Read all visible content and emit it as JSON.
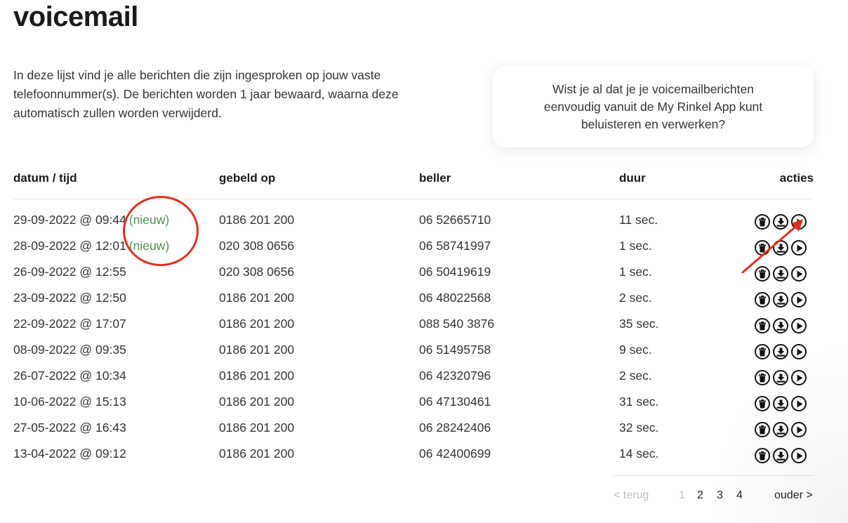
{
  "page": {
    "title": "voicemail",
    "intro": "In deze lijst vind je alle berichten die zijn ingesproken op jouw vaste telefoonnummer(s). De berichten worden 1 jaar bewaard, waarna deze automatisch zullen worden verwijderd.",
    "tip": "Wist je al dat je je voicemailberichten eenvoudig vanuit de My Rinkel App kunt beluisteren en verwerken?"
  },
  "table": {
    "headers": {
      "datetime": "datum / tijd",
      "called_on": "gebeld op",
      "caller": "beller",
      "duration": "duur",
      "actions": "acties"
    },
    "rows": [
      {
        "datetime": "29-09-2022 @ 09:44",
        "new": "(nieuw)",
        "called_on": "0186 201 200",
        "caller": "06 52665710",
        "duration": "11 sec."
      },
      {
        "datetime": "28-09-2022 @ 12:01",
        "new": "(nieuw)",
        "called_on": "020 308 0656",
        "caller": "06 58741997",
        "duration": "1 sec."
      },
      {
        "datetime": "26-09-2022 @ 12:55",
        "new": "",
        "called_on": "020 308 0656",
        "caller": "06 50419619",
        "duration": "1 sec."
      },
      {
        "datetime": "23-09-2022 @ 12:50",
        "new": "",
        "called_on": "0186 201 200",
        "caller": "06 48022568",
        "duration": "2 sec."
      },
      {
        "datetime": "22-09-2022 @ 17:07",
        "new": "",
        "called_on": "0186 201 200",
        "caller": "088 540 3876",
        "duration": "35 sec."
      },
      {
        "datetime": "08-09-2022 @ 09:35",
        "new": "",
        "called_on": "0186 201 200",
        "caller": "06 51495758",
        "duration": "9 sec."
      },
      {
        "datetime": "26-07-2022 @ 10:34",
        "new": "",
        "called_on": "0186 201 200",
        "caller": "06 42320796",
        "duration": "2 sec."
      },
      {
        "datetime": "10-06-2022 @ 15:13",
        "new": "",
        "called_on": "0186 201 200",
        "caller": "06 47130461",
        "duration": "31 sec."
      },
      {
        "datetime": "27-05-2022 @ 16:43",
        "new": "",
        "called_on": "0186 201 200",
        "caller": "06 28242406",
        "duration": "32 sec."
      },
      {
        "datetime": "13-04-2022 @ 09:12",
        "new": "",
        "called_on": "0186 201 200",
        "caller": "06 42400699",
        "duration": "14 sec."
      }
    ],
    "row_action_icons": [
      "trash-icon",
      "download-icon",
      "play-icon"
    ]
  },
  "pagination": {
    "back": "< terug",
    "pages": [
      "1",
      "2",
      "3",
      "4"
    ],
    "current": "1",
    "older": "ouder >"
  },
  "colors": {
    "new_badge": "#4e8f4e",
    "annotation": "#e0301e"
  }
}
